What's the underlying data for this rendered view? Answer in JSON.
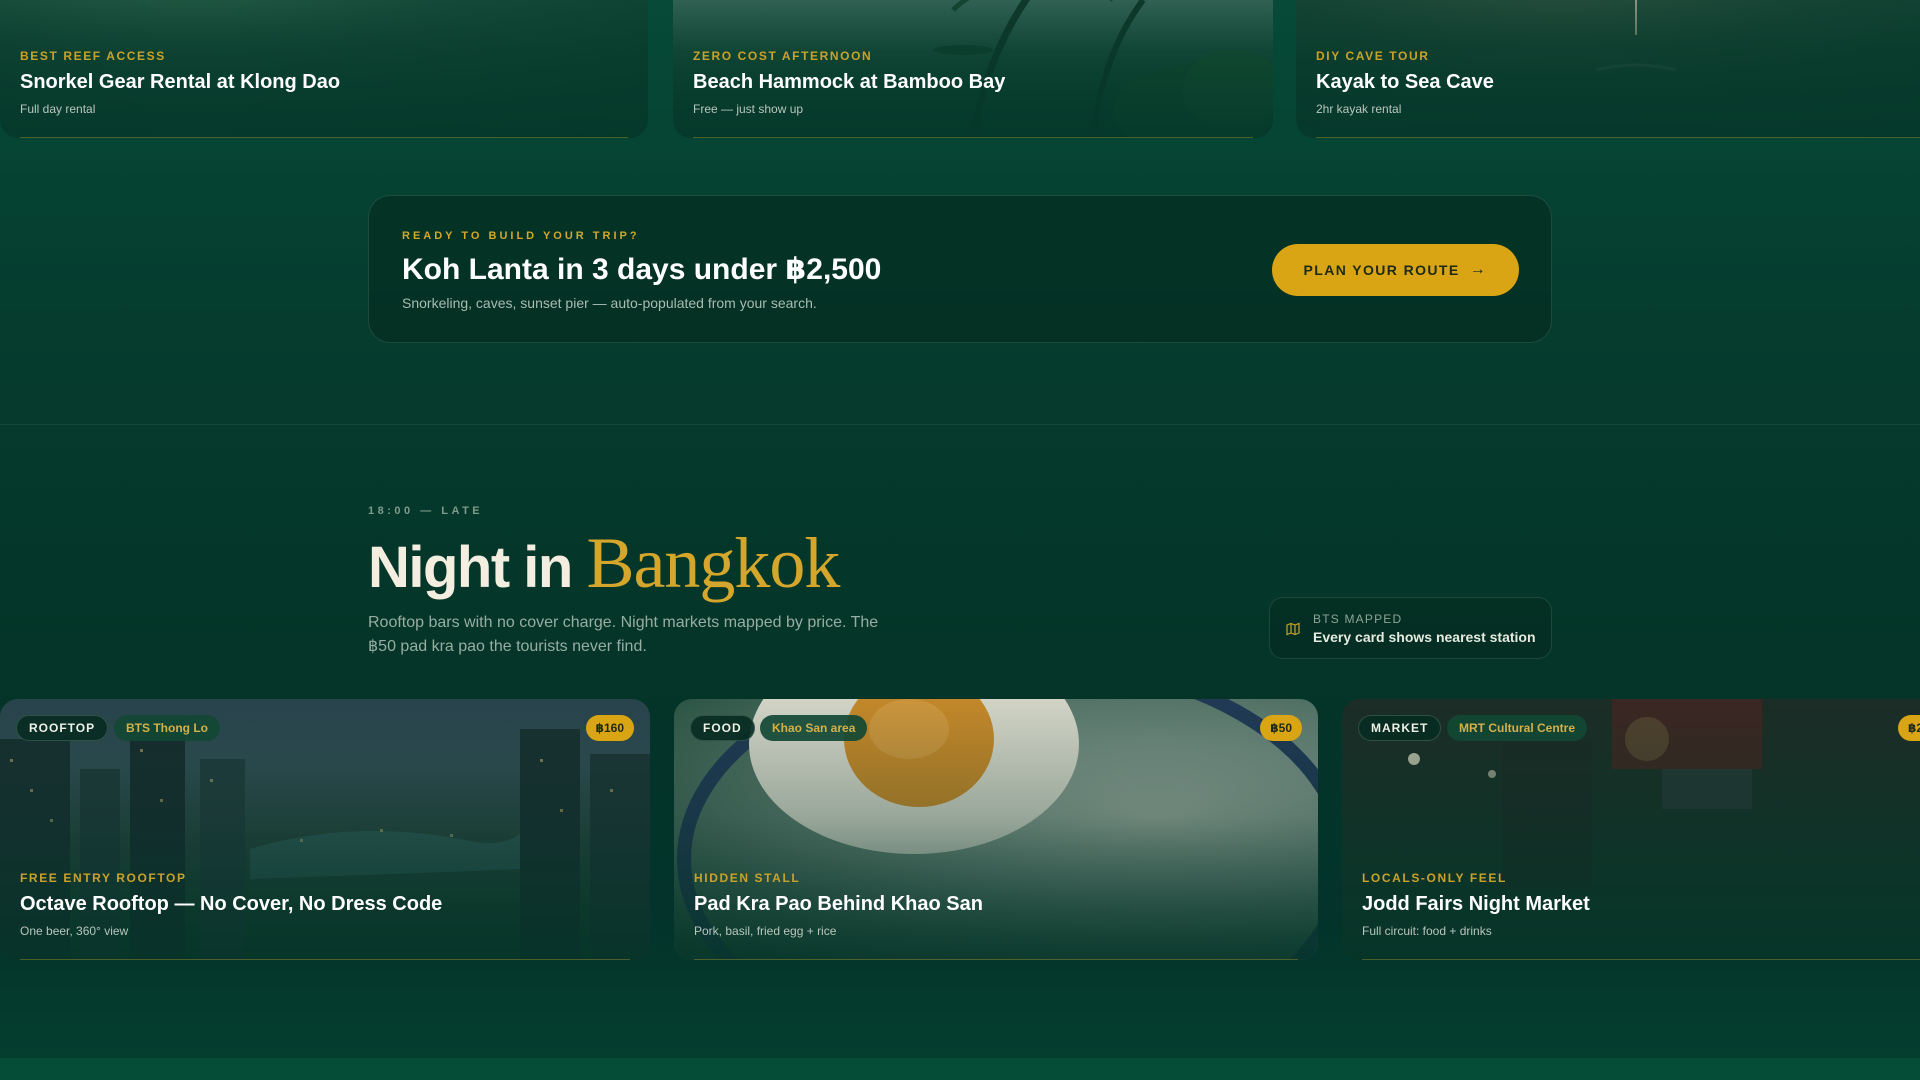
{
  "top_cards": [
    {
      "eyebrow": "BEST REEF ACCESS",
      "title": "Snorkel Gear Rental at Klong Dao",
      "sub": "Full day rental"
    },
    {
      "eyebrow": "ZERO COST AFTERNOON",
      "title": "Beach Hammock at Bamboo Bay",
      "sub": "Free — just show up"
    },
    {
      "eyebrow": "DIY CAVE TOUR",
      "title": "Kayak to Sea Cave",
      "sub": "2hr kayak rental"
    }
  ],
  "cta": {
    "kicker": "READY TO BUILD YOUR TRIP?",
    "headline": "Koh Lanta in 3 days under ฿2,500",
    "sub": "Snorkeling, caves, sunset pier — auto-populated from your search.",
    "button": "PLAN YOUR ROUTE"
  },
  "section": {
    "kicker": "18:00 — LATE",
    "title_main": "Night in ",
    "title_accent": "Bangkok",
    "desc": "Rooftop bars with no cover charge. Night markets mapped by price. The ฿50 pad kra pao the tourists never find.",
    "bts_label": "BTS MAPPED",
    "bts_text": "Every card shows nearest station"
  },
  "night_cards": [
    {
      "category": "ROOFTOP",
      "location": "BTS Thong Lo",
      "price": "฿160",
      "eyebrow": "FREE ENTRY ROOFTOP",
      "title": "Octave Rooftop — No Cover, No Dress Code",
      "sub": "One beer, 360° view"
    },
    {
      "category": "FOOD",
      "location": "Khao San area",
      "price": "฿50",
      "eyebrow": "HIDDEN STALL",
      "title": "Pad Kra Pao Behind Khao San",
      "sub": "Pork, basil, fried egg + rice"
    },
    {
      "category": "MARKET",
      "location": "MRT Cultural Centre",
      "price": "฿2",
      "eyebrow": "LOCALS-ONLY FEEL",
      "title": "Jodd Fairs Night Market",
      "sub": "Full circuit: food + drinks"
    }
  ],
  "colors": {
    "accent": "#d9a514",
    "background": "#053a2d",
    "text": "#f2efe6"
  }
}
